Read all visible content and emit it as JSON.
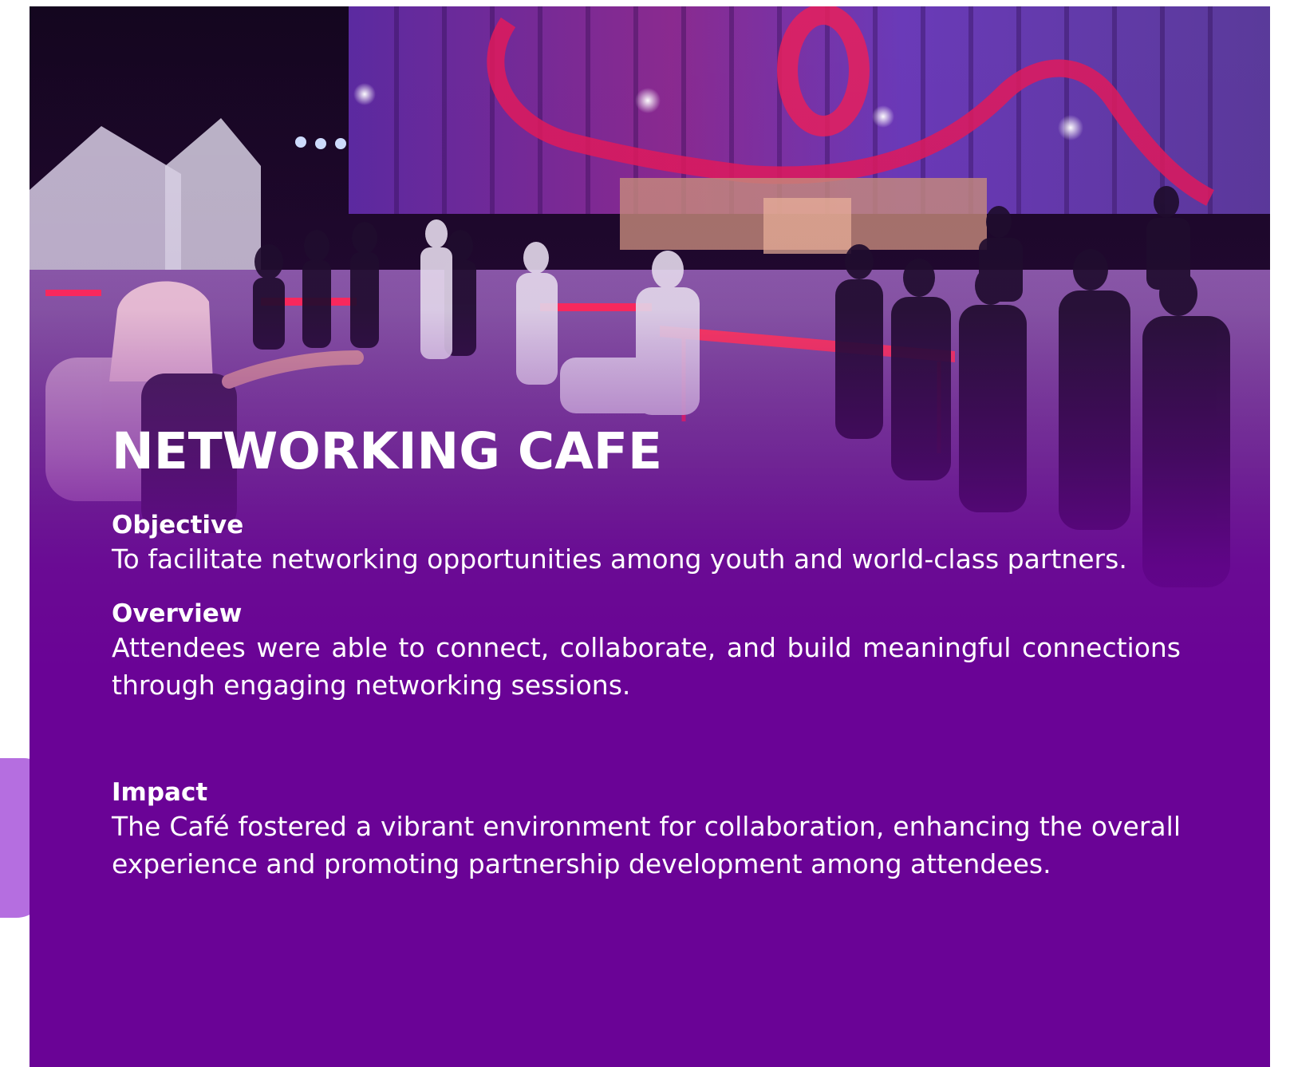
{
  "colors": {
    "brand_purple": "#6a0396",
    "accent_lavender": "#b56ee0",
    "text": "#ffffff"
  },
  "hero": {
    "image_alt": "Event photo: attendees seated at red tables in an evening networking cafe session"
  },
  "page": {
    "title": "NETWORKING CAFE",
    "sections": [
      {
        "heading": "Objective",
        "text": "To facilitate networking opportunities among youth and world-class partners."
      },
      {
        "heading": "Overview",
        "text": "Attendees were able to connect, collaborate, and build meaningful connections through engaging networking sessions."
      },
      {
        "heading": "Impact",
        "text": "The Café fostered a vibrant environment for collaboration, enhancing the overall experience and promoting partnership development among attendees."
      }
    ]
  }
}
